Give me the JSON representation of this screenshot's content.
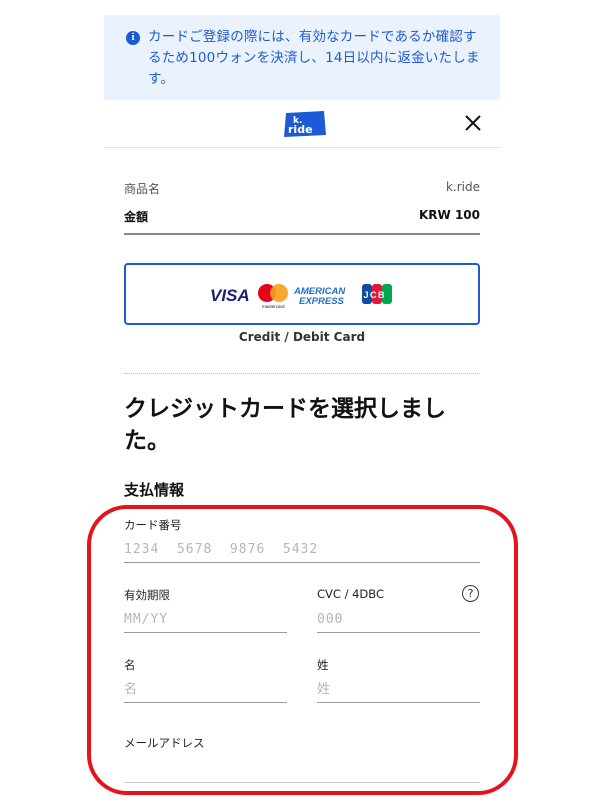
{
  "banner": {
    "text": "カードご登録の際には、有効なカードであるか確認するため100ウォンを決済し、14日以内に返金いたします。",
    "icon": "info-icon",
    "color": "#1d5bd6"
  },
  "header": {
    "logo_text_k": "k.",
    "logo_text_ride": "ride",
    "close_icon": "close-icon"
  },
  "order": {
    "product_label": "商品名",
    "product_value": "k.ride",
    "amount_label": "金額",
    "amount_value": "KRW 100"
  },
  "payment_method": {
    "brands": [
      "VISA",
      "mastercard",
      "AMERICAN EXPRESS",
      "JCB"
    ],
    "brand_visa": "VISA",
    "brand_mastercard": "mastercard",
    "brand_amex_1": "AMERICAN",
    "brand_amex_2": "EXPRESS",
    "brand_jcb": "JCB",
    "caption": "Credit / Debit Card",
    "accent": "#1d5bd6"
  },
  "form": {
    "heading": "クレジットカードを選択しました。",
    "section_title": "支払情報",
    "card_number": {
      "label": "カード番号",
      "placeholder": "1234  5678  9876  5432"
    },
    "expiry": {
      "label": "有効期限",
      "placeholder": "MM/YY"
    },
    "cvc": {
      "label": "CVC / 4DBC",
      "placeholder": "000",
      "help": "?"
    },
    "first_name": {
      "label": "名",
      "placeholder": "名"
    },
    "last_name": {
      "label": "姓",
      "placeholder": "姓"
    },
    "email": {
      "label": "メールアドレス"
    }
  },
  "highlight_color": "#e3141e"
}
